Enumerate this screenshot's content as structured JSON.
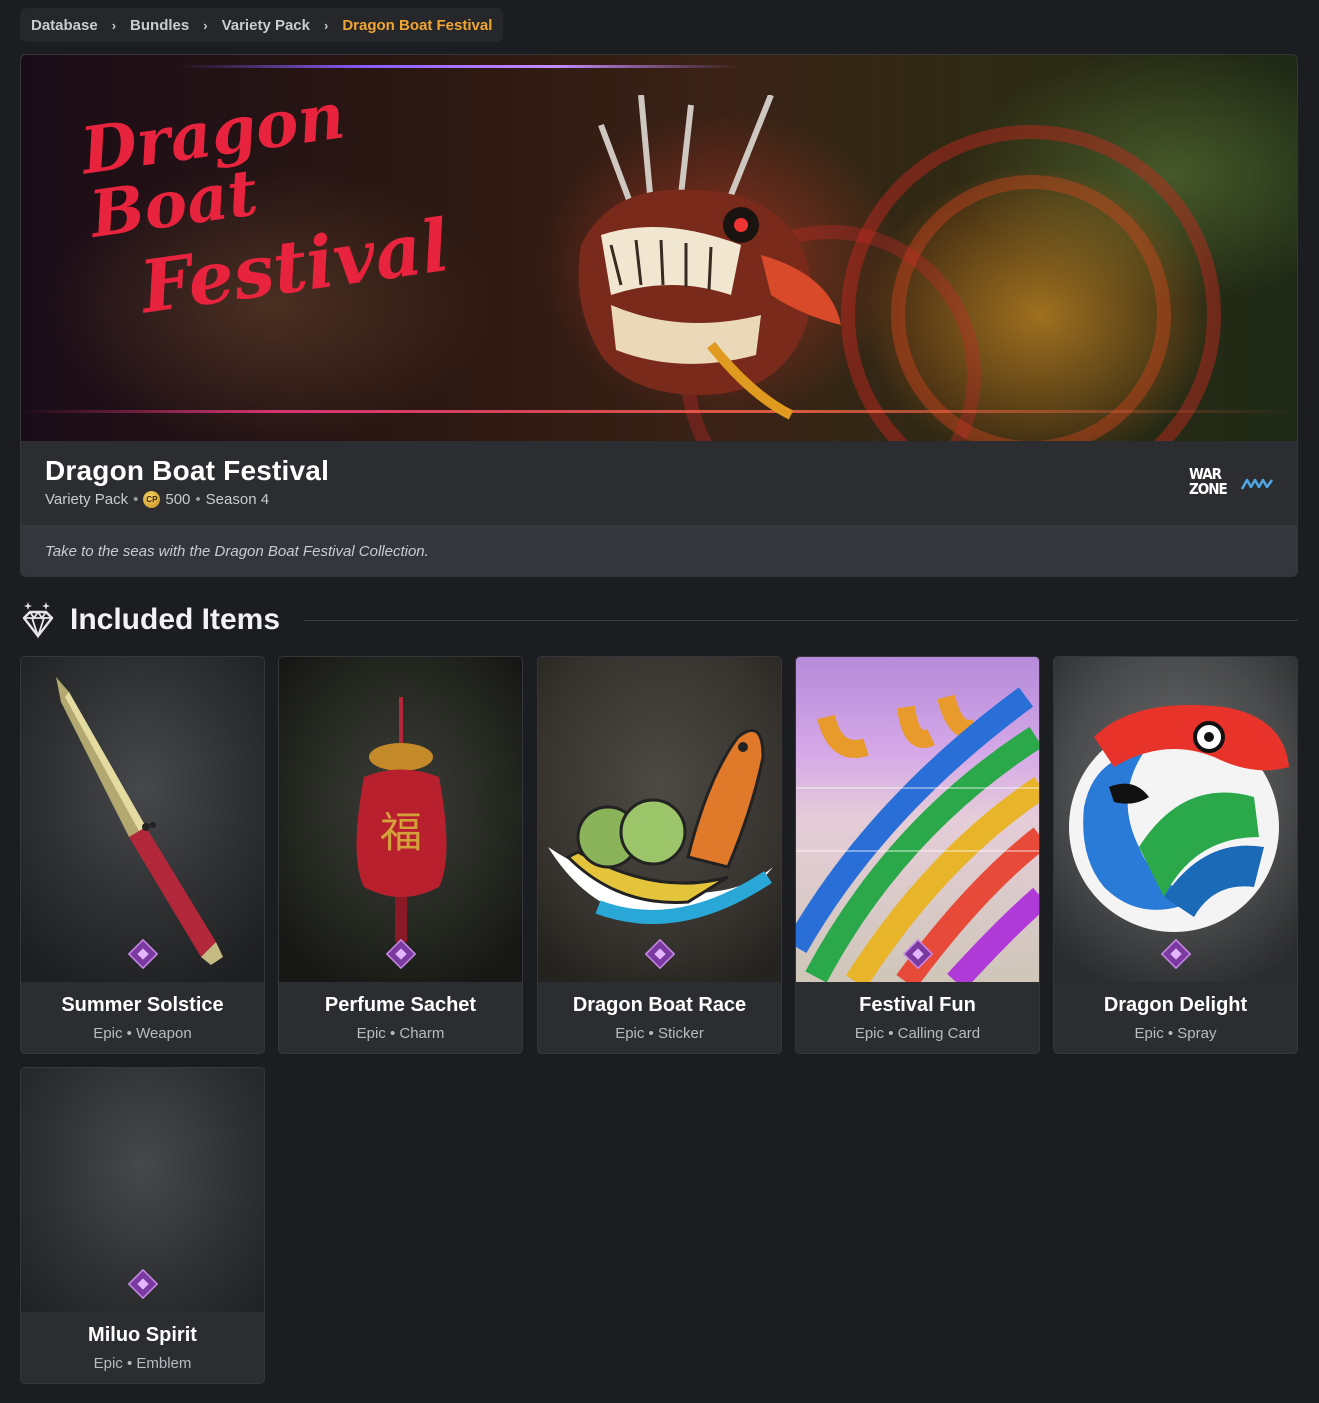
{
  "breadcrumb": {
    "items": [
      "Database",
      "Bundles",
      "Variety Pack"
    ],
    "current": "Dragon Boat Festival",
    "separator": "›"
  },
  "hero": {
    "banner_text_line1": "Dragon Boat",
    "banner_text_line2": "Festival",
    "title": "Dragon Boat Festival",
    "type": "Variety Pack",
    "currency_icon_label": "CP",
    "price": "500",
    "season": "Season 4",
    "logos": [
      "warzone-logo",
      "mw-logo"
    ],
    "logo_warzone_line1": "WAR",
    "logo_warzone_line2": "ZONE",
    "description": "Take to the seas with the Dragon Boat Festival Collection."
  },
  "section": {
    "title": "Included Items",
    "icon": "diamond-icon"
  },
  "items": [
    {
      "name": "Summer Solstice",
      "rarity": "Epic",
      "category": "Weapon"
    },
    {
      "name": "Perfume Sachet",
      "rarity": "Epic",
      "category": "Charm"
    },
    {
      "name": "Dragon Boat Race",
      "rarity": "Epic",
      "category": "Sticker"
    },
    {
      "name": "Festival Fun",
      "rarity": "Epic",
      "category": "Calling Card"
    },
    {
      "name": "Dragon Delight",
      "rarity": "Epic",
      "category": "Spray"
    },
    {
      "name": "Miluo Spirit",
      "rarity": "Epic",
      "category": "Emblem"
    }
  ],
  "colors": {
    "background": "#1c1d20",
    "panel": "#2b2d31",
    "accent_breadcrumb": "#f1a531",
    "rarity_epic": "#b05bd6"
  }
}
